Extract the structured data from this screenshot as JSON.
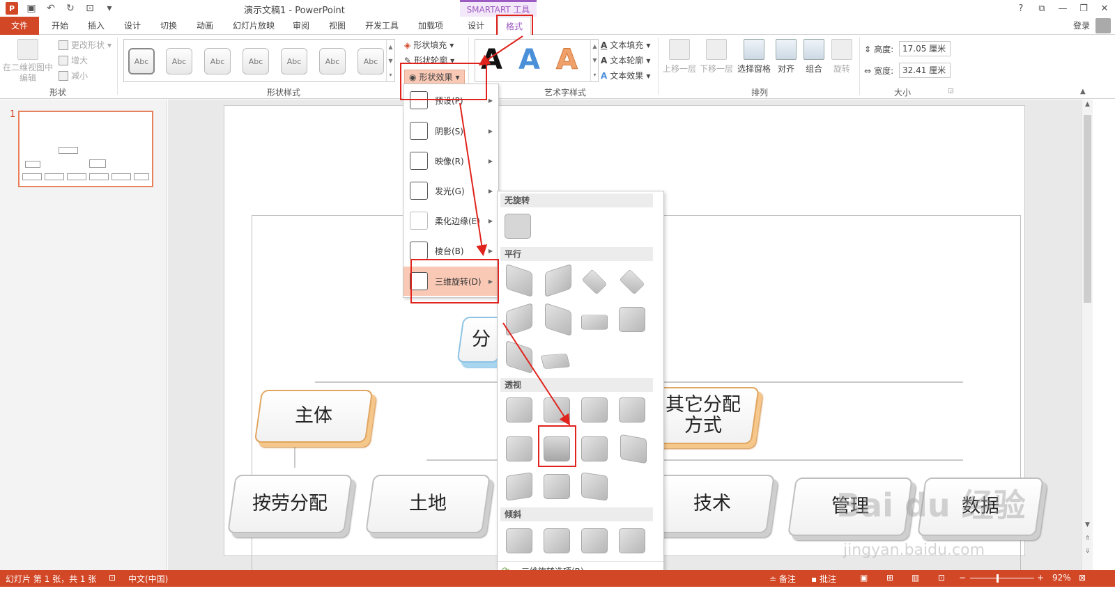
{
  "titlebar": {
    "title": "演示文稿1 - PowerPoint",
    "contextual_label": "SMARTART 工具",
    "help": "?",
    "ribbon_display": "⧉",
    "minimize": "—",
    "restore": "❐",
    "close": "✕"
  },
  "tabs": {
    "file": "文件",
    "home": "开始",
    "insert": "插入",
    "design": "设计",
    "transitions": "切换",
    "animations": "动画",
    "slideshow": "幻灯片放映",
    "review": "审阅",
    "view": "视图",
    "developer": "开发工具",
    "addins": "加载项",
    "smartart_design": "设计",
    "smartart_format": "格式",
    "signin": "登录"
  },
  "ribbon": {
    "shapes_group": {
      "edit_2d": "在二维视图中\n编辑",
      "change_shape": "更改形状",
      "larger": "增大",
      "smaller": "减小",
      "label": "形状"
    },
    "shape_styles": {
      "swatches": [
        "Abc",
        "Abc",
        "Abc",
        "Abc",
        "Abc",
        "Abc",
        "Abc"
      ],
      "fill": "形状填充",
      "outline": "形状轮廓",
      "effects": "形状效果",
      "label": "形状样式"
    },
    "wordart": {
      "letters": [
        "A",
        "A",
        "A"
      ],
      "text_fill": "文本填充",
      "text_outline": "文本轮廓",
      "text_effects": "文本效果",
      "label": "艺术字样式"
    },
    "arrange": {
      "bring_forward": "上移一层",
      "send_backward": "下移一层",
      "selection_pane": "选择窗格",
      "align": "对齐",
      "group": "组合",
      "rotate": "旋转",
      "label": "排列"
    },
    "size": {
      "height_label": "高度:",
      "height_value": "17.05 厘米",
      "width_label": "宽度:",
      "width_value": "32.41 厘米",
      "label": "大小"
    }
  },
  "thumbnails": {
    "slide_number": "1"
  },
  "effects_menu": {
    "items": [
      {
        "label": "预设(P)"
      },
      {
        "label": "阴影(S)"
      },
      {
        "label": "映像(R)"
      },
      {
        "label": "发光(G)"
      },
      {
        "label": "柔化边缘(E)"
      },
      {
        "label": "棱台(B)"
      },
      {
        "label": "三维旋转(D)"
      }
    ]
  },
  "rotation_submenu": {
    "sections": {
      "none": "无旋转",
      "parallel": "平行",
      "perspective": "透视",
      "oblique": "倾斜"
    },
    "footer": "三维旋转选项(R)..."
  },
  "smartart": {
    "top": "分",
    "level2": [
      "主体",
      "其它分配\n方式"
    ],
    "level3": [
      "按劳分配",
      "土地",
      "技术",
      "管理",
      "数据"
    ]
  },
  "statusbar": {
    "slide_info": "幻灯片 第 1 张，共 1 张",
    "language": "中文(中国)",
    "notes": "备注",
    "comments": "批注",
    "zoom": "92%"
  },
  "watermark": {
    "brand": "Bai du 经验",
    "url": "jingyan.baidu.com"
  },
  "colors": {
    "accent": "#d24726",
    "highlight": "#e0231c",
    "contextual": "#9c5ac3"
  }
}
